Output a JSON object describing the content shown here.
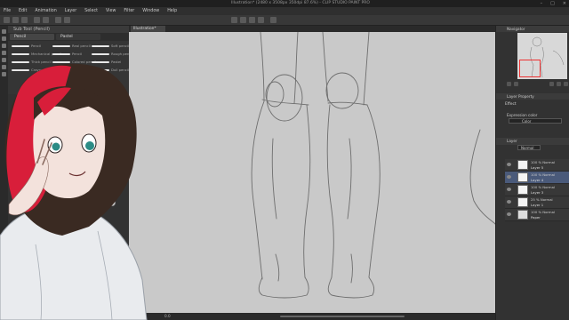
{
  "window": {
    "title": "Illustration* (2480 x 3508px 350dpi 87.6%) - CLIP STUDIO PAINT PRO",
    "controls": [
      "–",
      "□",
      "×"
    ]
  },
  "menu": [
    "File",
    "Edit",
    "Animation",
    "Layer",
    "Select",
    "View",
    "Filter",
    "Window",
    "Help"
  ],
  "left_panel": {
    "header": "Sub Tool (Pencil)",
    "tabs": [
      "Pencil",
      "Pastel"
    ],
    "brushes": [
      "Pencil",
      "Real pencil",
      "Soft pencil",
      "Mechanical pencil",
      "Pencil",
      "Rough pencil",
      "Thick pencil",
      "Colored pencil",
      "Pastel",
      "Crayon",
      "Charcoal",
      "Dull pencil"
    ]
  },
  "canvas": {
    "doc_tab": "Illustration*"
  },
  "status": {
    "zoom": "87.6",
    "position": "0.0"
  },
  "right_panel": {
    "navigator_header": "Navigator",
    "layer_property_header": "Layer Property",
    "effect_label": "Effect",
    "expression_color_label": "Expression color",
    "expression_color_value": "Color",
    "layer_header": "Layer",
    "blend_mode": "Normal",
    "layers": [
      {
        "mode": "100 % Normal",
        "name": "Layer 5",
        "selected": false
      },
      {
        "mode": "100 % Normal",
        "name": "Layer 4",
        "selected": true
      },
      {
        "mode": "100 % Normal",
        "name": "Layer 3",
        "selected": false
      },
      {
        "mode": "25 % Normal",
        "name": "Layer 1",
        "selected": false
      },
      {
        "mode": "100 % Normal",
        "name": "Paper",
        "selected": false
      }
    ]
  },
  "colors": {
    "accent": "#4a5a7a",
    "nav_frame": "#e33333",
    "hair_red": "#d81e3a",
    "hair_dark": "#3a2a22"
  }
}
